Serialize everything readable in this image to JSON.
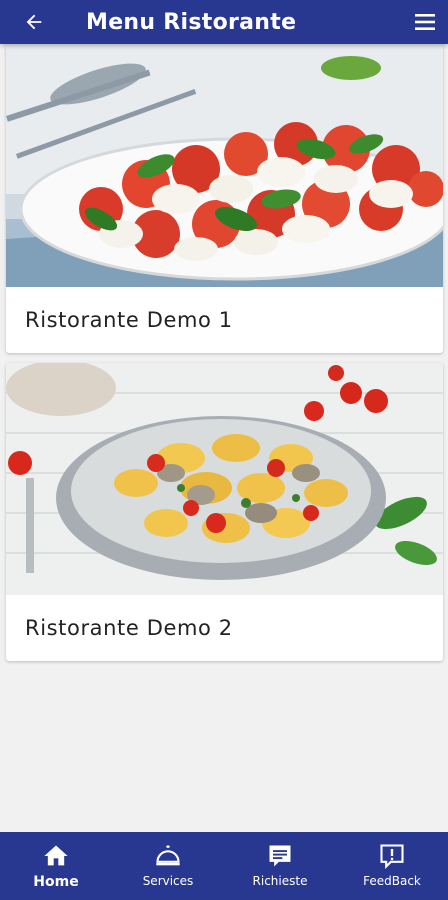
{
  "header": {
    "title": "Menu Ristorante",
    "back_icon": "arrow-left-icon",
    "menu_icon": "hamburger-menu-icon"
  },
  "restaurants": [
    {
      "name": "Ristorante Demo 1",
      "image": "caprese-salad-photo"
    },
    {
      "name": "Ristorante Demo 2",
      "image": "pasta-with-clams-photo"
    }
  ],
  "bottom_nav": [
    {
      "label": "Home",
      "icon": "home-icon",
      "active": true
    },
    {
      "label": "Services",
      "icon": "cloche-icon",
      "active": false
    },
    {
      "label": "Richieste",
      "icon": "chat-bubble-icon",
      "active": false
    },
    {
      "label": "FeedBack",
      "icon": "feedback-icon",
      "active": false
    }
  ],
  "colors": {
    "primary": "#283891",
    "background": "#f1f1f1",
    "card": "#ffffff"
  }
}
